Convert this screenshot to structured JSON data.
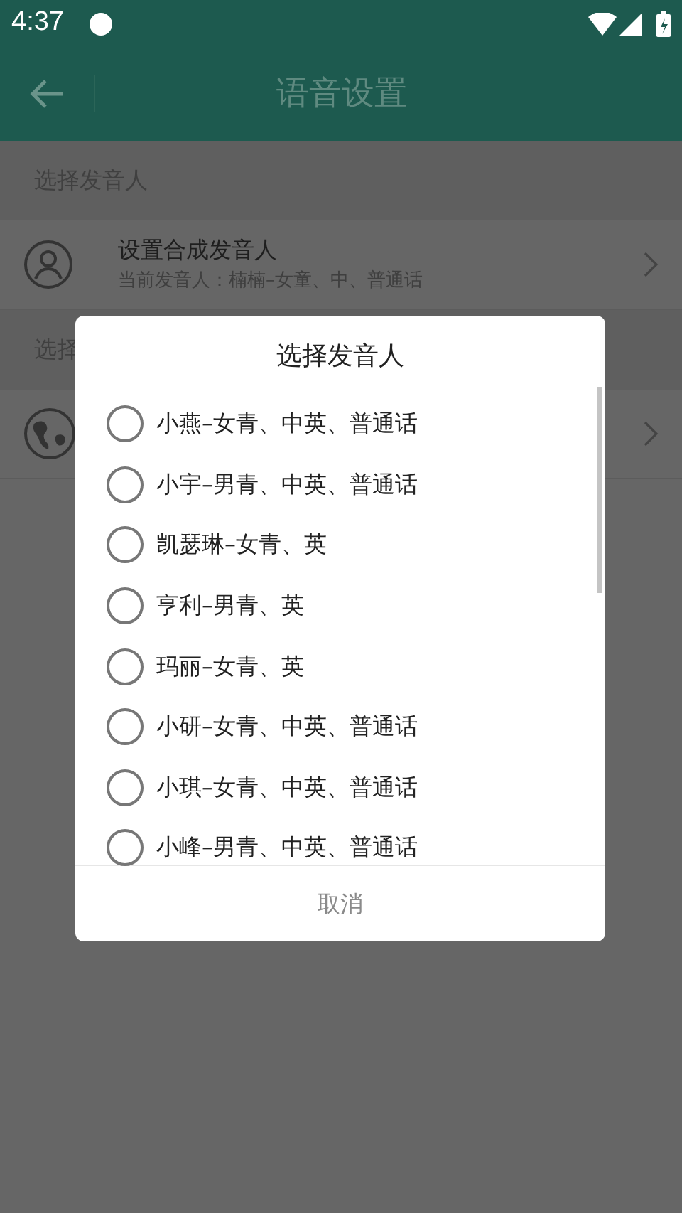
{
  "status_bar": {
    "time": "4:37"
  },
  "header": {
    "title": "语音设置"
  },
  "sections": [
    {
      "title": "选择发音人",
      "rows": [
        {
          "kind": "person",
          "title": "设置合成发音人",
          "subtitle": "当前发音人：楠楠–女童、中、普通话"
        }
      ]
    },
    {
      "title": "选择",
      "rows": [
        {
          "kind": "globe"
        }
      ]
    }
  ],
  "dialog": {
    "title": "选择发音人",
    "options": [
      {
        "label": "小燕–女青、中英、普通话",
        "selected": false
      },
      {
        "label": "小宇–男青、中英、普通话",
        "selected": false
      },
      {
        "label": "凯瑟琳–女青、英",
        "selected": false
      },
      {
        "label": "亨利–男青、英",
        "selected": false
      },
      {
        "label": "玛丽–女青、英",
        "selected": false
      },
      {
        "label": "小研–女青、中英、普通话",
        "selected": false
      },
      {
        "label": "小琪–女青、中英、普通话",
        "selected": false
      },
      {
        "label": "小峰–男青、中英、普通话",
        "selected": false
      }
    ],
    "cancel": "取消"
  }
}
